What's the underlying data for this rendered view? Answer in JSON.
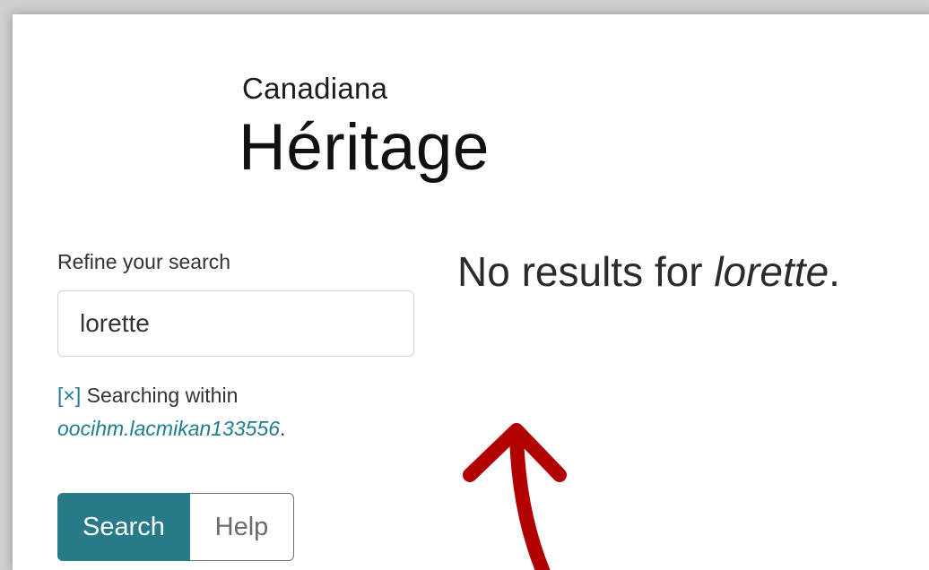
{
  "brand": {
    "line1": "Canadiana",
    "line2": "Héritage",
    "colors": {
      "green": "#7cc242",
      "teal": "#1a7f8e"
    }
  },
  "sidebar": {
    "refine_label": "Refine your search",
    "search_value": "lorette",
    "within": {
      "remove_label": "[×]",
      "text": "Searching within",
      "target": "oocihm.lacmikan133556",
      "suffix": "."
    },
    "buttons": {
      "search_label": "Search",
      "help_label": "Help"
    }
  },
  "main": {
    "no_results_prefix": "No results for ",
    "query": "lorette",
    "suffix": "."
  },
  "annotation": {
    "icon": "red-arrow-up-icon",
    "color": "#b00000"
  },
  "colors": {
    "accent": "#277a87",
    "link": "#1f7d8d",
    "text": "#333333"
  }
}
